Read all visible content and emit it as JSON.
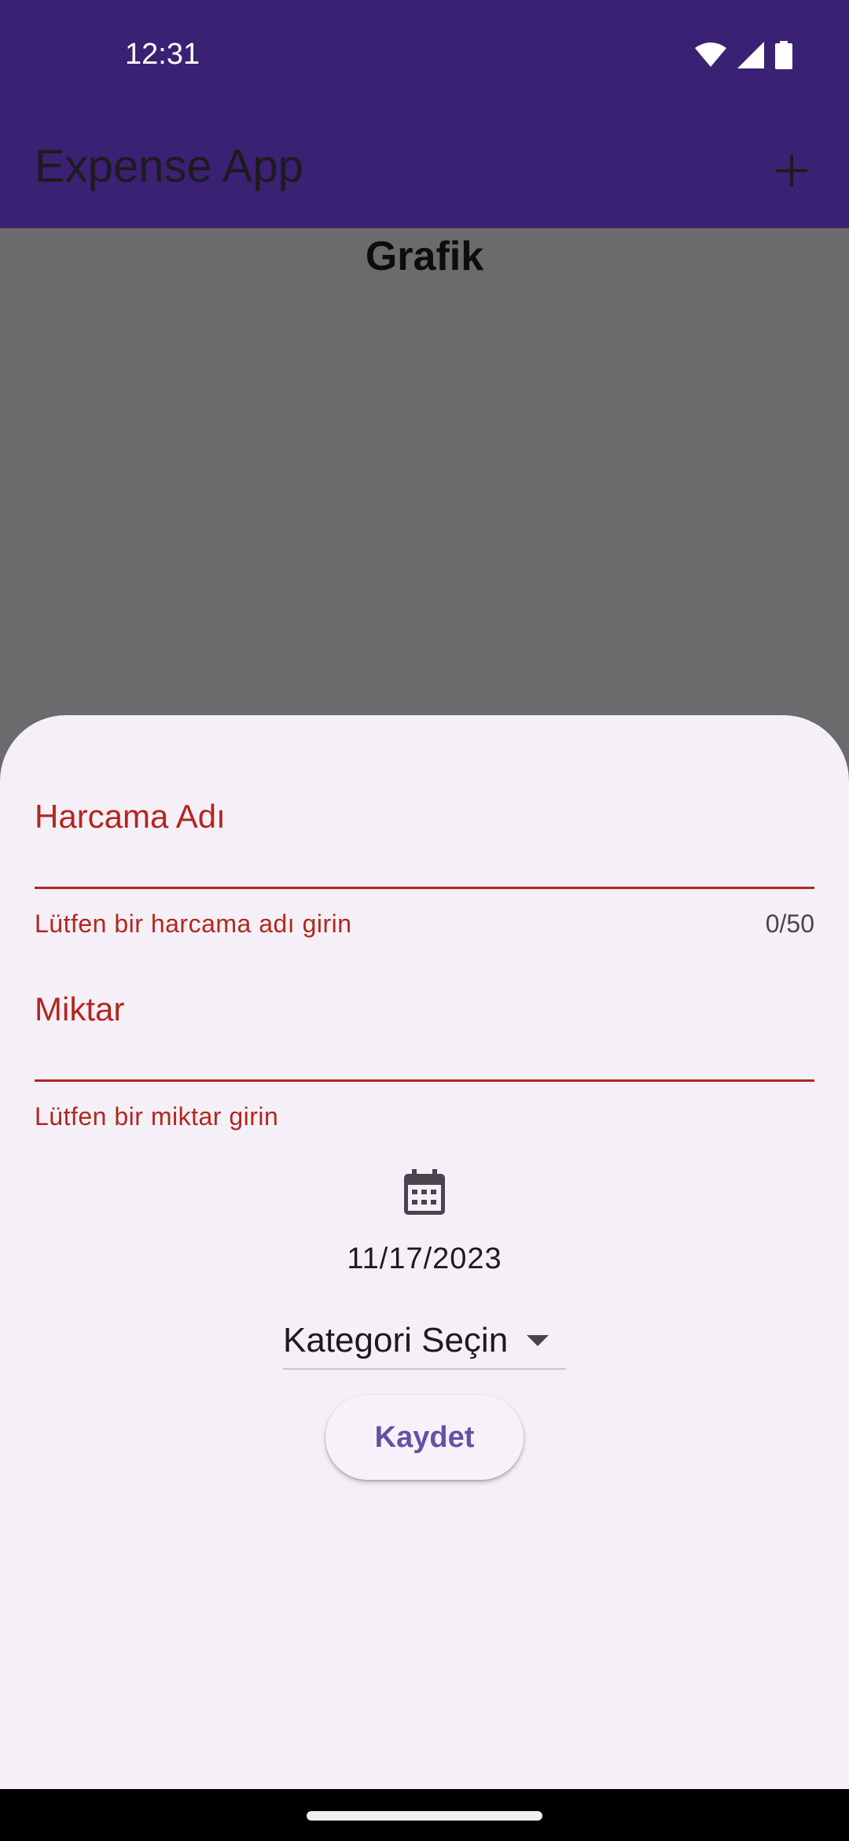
{
  "status_bar": {
    "time": "12:31",
    "icons": [
      "wifi-icon",
      "signal-icon",
      "battery-icon"
    ]
  },
  "app_bar": {
    "title": "Expense App",
    "action_icon": "add-icon"
  },
  "background": {
    "section_title": "Grafik"
  },
  "form": {
    "name_field": {
      "label": "Harcama Adı",
      "error": "Lütfen bir harcama adı girin",
      "counter": "0/50"
    },
    "amount_field": {
      "label": "Miktar",
      "error": "Lütfen bir miktar girin"
    },
    "date": {
      "icon": "calendar-icon",
      "value": "11/17/2023"
    },
    "category": {
      "selected": "Kategori Seçin",
      "icon": "dropdown-arrow-icon"
    },
    "save_label": "Kaydet"
  },
  "colors": {
    "primary": "#3b2173",
    "error": "#b3261e",
    "accent": "#6750a4",
    "sheet": "#f5f0f7",
    "scrim": "#6b6a6c"
  }
}
